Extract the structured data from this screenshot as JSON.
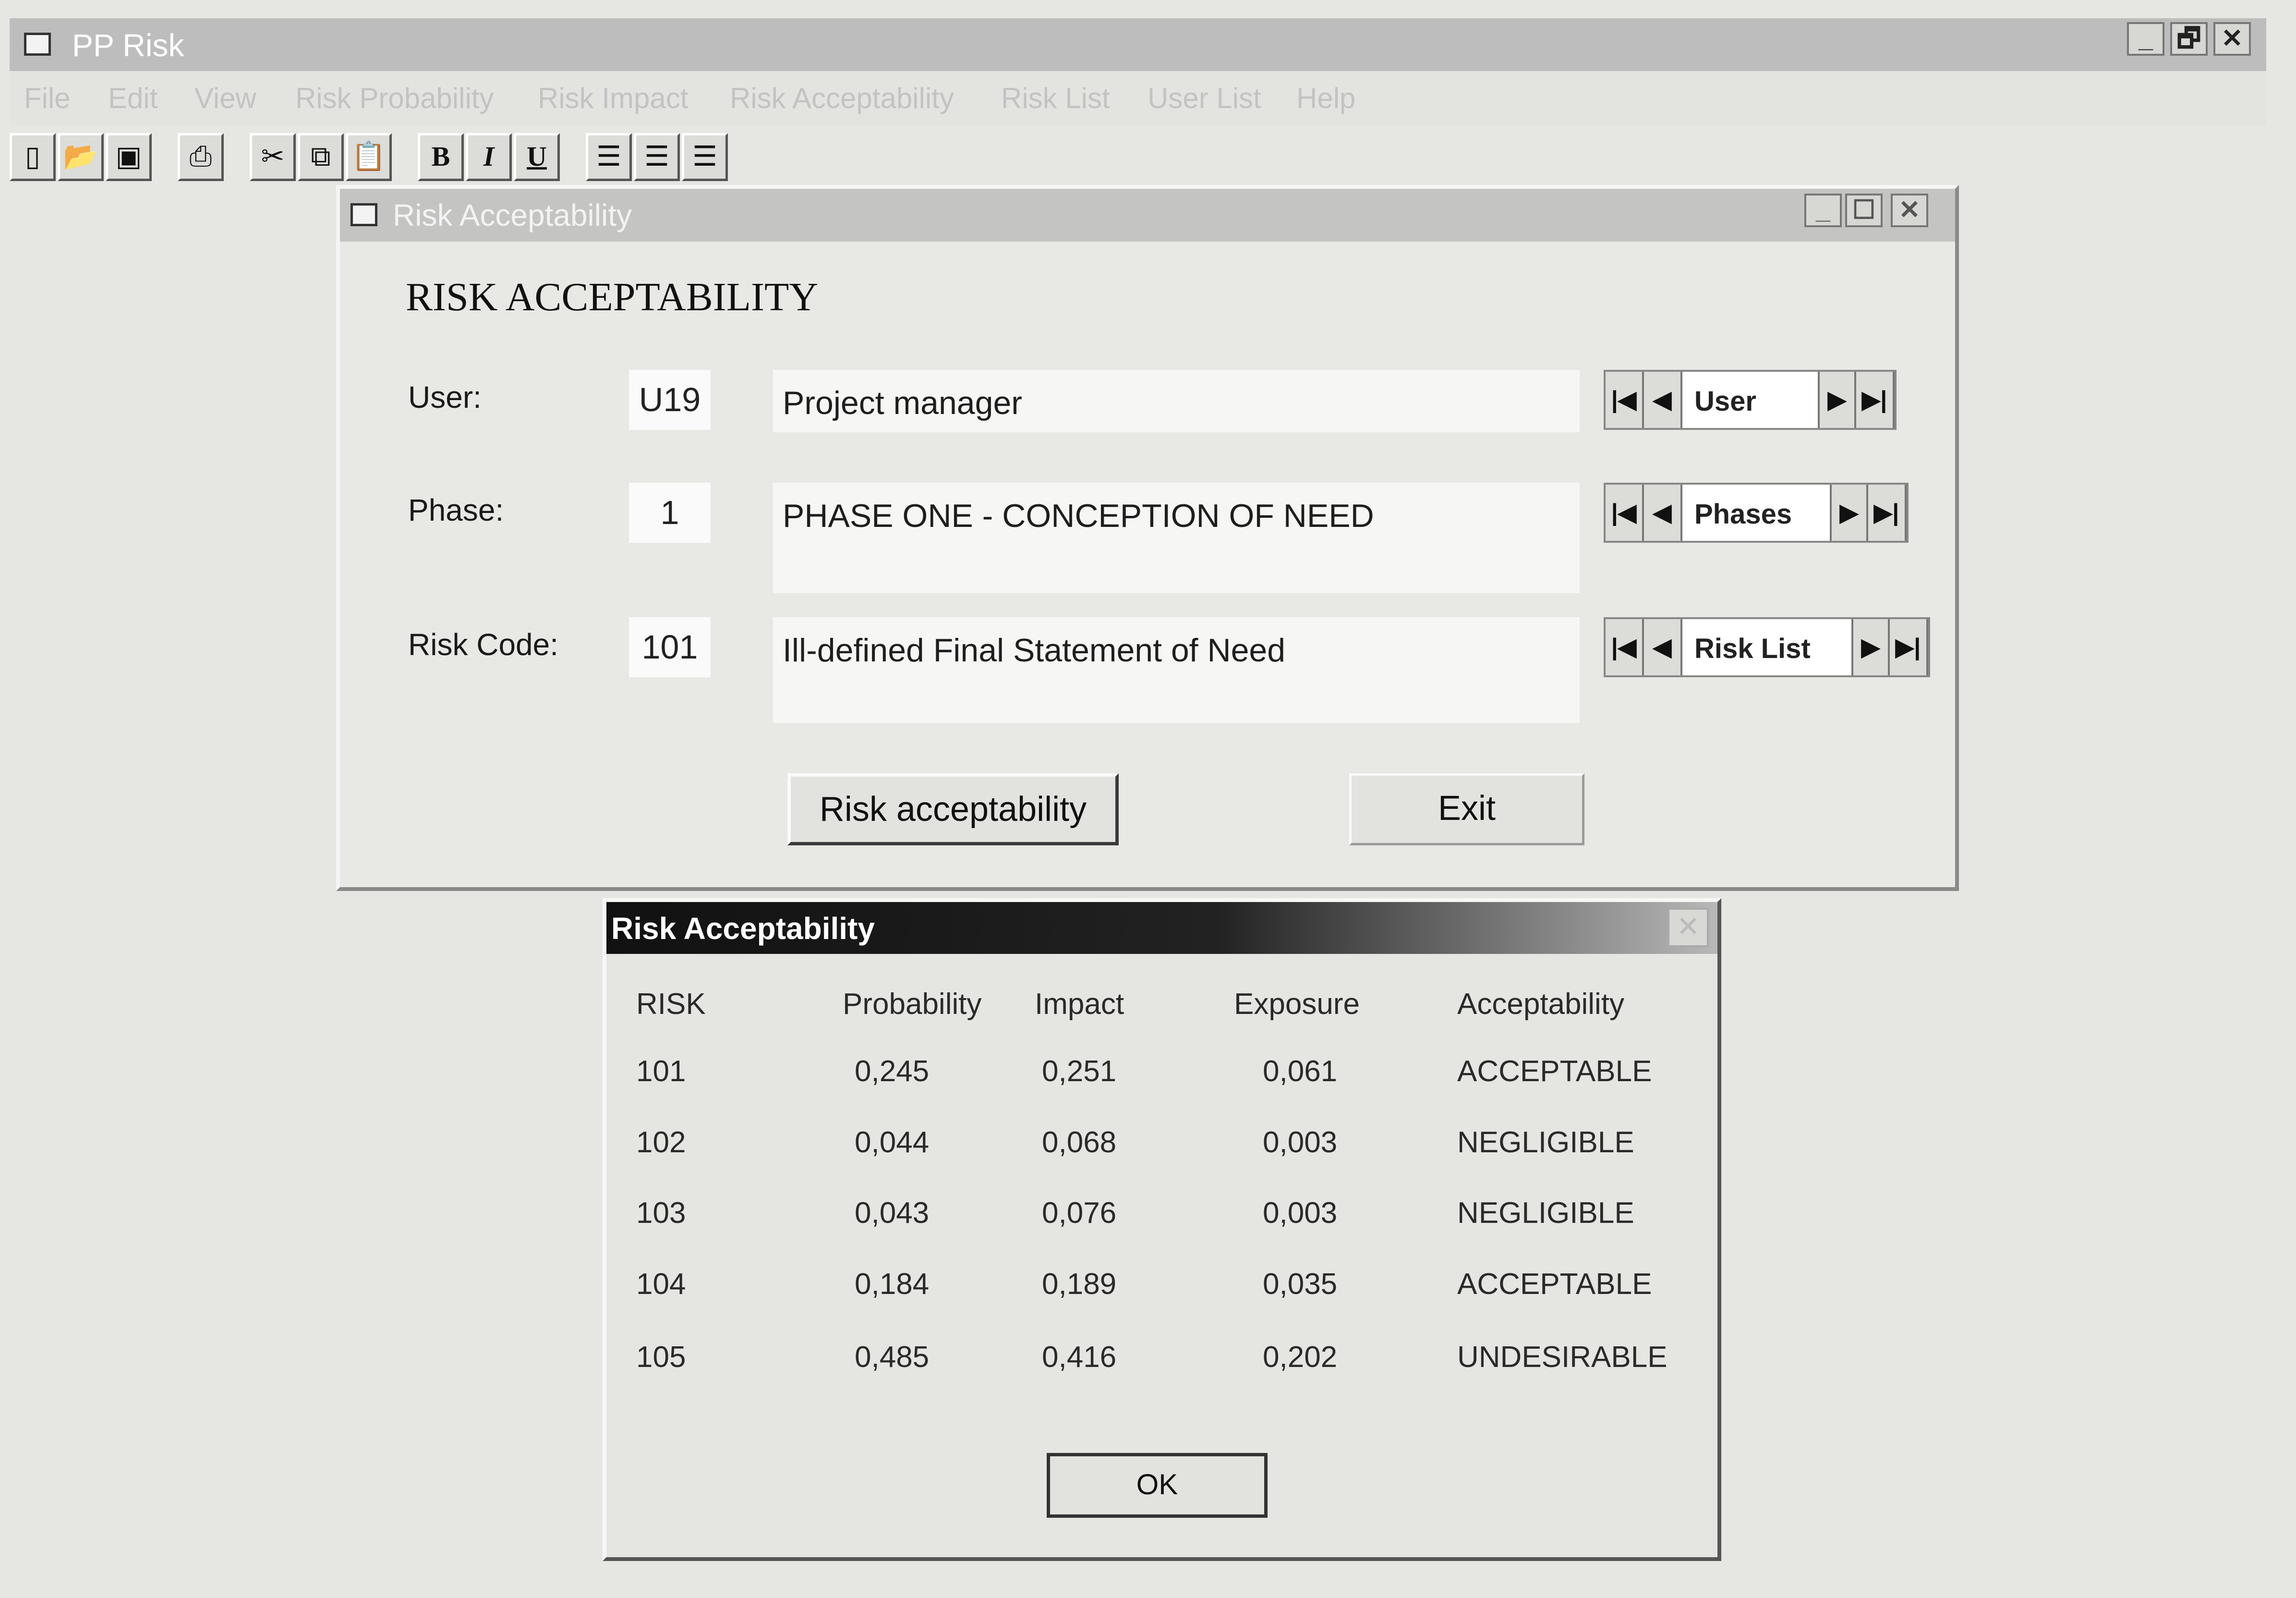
{
  "app": {
    "title": "PP Risk",
    "window_controls": {
      "minimize": "_",
      "restore": "🗗",
      "close": "✕"
    },
    "menu": [
      "File",
      "Edit",
      "View",
      "Risk Probability",
      "Risk Impact",
      "Risk Acceptability",
      "Risk List",
      "User List",
      "Help"
    ],
    "toolbar": {
      "bold": "B",
      "italic": "I",
      "underline": "U"
    }
  },
  "form": {
    "window_title": "Risk Acceptability",
    "window_controls": {
      "minimize": "_",
      "maximize": "☐",
      "close": "✕"
    },
    "heading": "RISK ACCEPTABILITY",
    "user": {
      "label": "User:",
      "code": "U19",
      "description": "Project manager",
      "nav_caption": "User"
    },
    "phase": {
      "label": "Phase:",
      "code": "1",
      "description": "PHASE ONE - CONCEPTION OF NEED",
      "nav_caption": "Phases"
    },
    "risk": {
      "label": "Risk Code:",
      "code": "101",
      "description": "Ill-defined Final Statement of Need",
      "nav_caption": "Risk List"
    },
    "nav_glyphs": {
      "first": "|◀",
      "prev": "◀",
      "next": "▶",
      "last": "▶|"
    },
    "risk_acceptability_button": "Risk acceptability",
    "exit_button": "Exit"
  },
  "dialog": {
    "title": "Risk Acceptability",
    "close": "✕",
    "columns": [
      "RISK",
      "Probability",
      "Impact",
      "Exposure",
      "Acceptability"
    ],
    "rows": [
      [
        "101",
        "0,245",
        "0,251",
        "0,061",
        "ACCEPTABLE"
      ],
      [
        "102",
        "0,044",
        "0,068",
        "0,003",
        "NEGLIGIBLE"
      ],
      [
        "103",
        "0,043",
        "0,076",
        "0,003",
        "NEGLIGIBLE"
      ],
      [
        "104",
        "0,184",
        "0,189",
        "0,035",
        "ACCEPTABLE"
      ],
      [
        "105",
        "0,485",
        "0,416",
        "0,202",
        "UNDESIRABLE"
      ]
    ],
    "ok_button": "OK"
  }
}
